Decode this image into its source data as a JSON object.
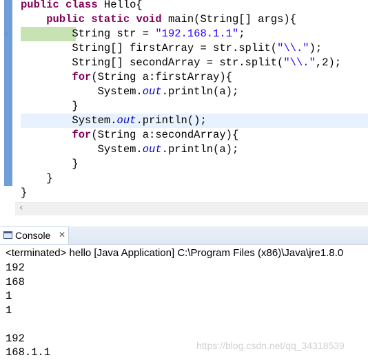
{
  "editor": {
    "lines": [
      [
        [
          "kw",
          "public class "
        ],
        [
          "t",
          "Hello{"
        ]
      ],
      [
        [
          "t",
          "    "
        ],
        [
          "kw",
          "public static void "
        ],
        [
          "t",
          "main(String[] args){"
        ]
      ],
      [
        [
          "t",
          "        String str = "
        ],
        [
          "str",
          "\"192.168.1.1\""
        ],
        [
          "t",
          ";"
        ]
      ],
      [
        [
          "t",
          "        String[] firstArray = str.split("
        ],
        [
          "str",
          "\"\\\\.\""
        ],
        [
          "t",
          ");"
        ]
      ],
      [
        [
          "t",
          "        String[] secondArray = str.split("
        ],
        [
          "str",
          "\"\\\\.\""
        ],
        [
          "t",
          ",2);"
        ]
      ],
      [
        [
          "t",
          "        "
        ],
        [
          "kw",
          "for"
        ],
        [
          "t",
          "(String a:firstArray){"
        ]
      ],
      [
        [
          "t",
          "            System."
        ],
        [
          "fld",
          "out"
        ],
        [
          "t",
          ".println(a);"
        ]
      ],
      [
        [
          "t",
          "        }"
        ]
      ],
      [
        [
          "t",
          "        System."
        ],
        [
          "fld",
          "out"
        ],
        [
          "t",
          ".println();"
        ]
      ],
      [
        [
          "t",
          "        "
        ],
        [
          "kw",
          "for"
        ],
        [
          "t",
          "(String a:secondArray){"
        ]
      ],
      [
        [
          "t",
          "            System."
        ],
        [
          "fld",
          "out"
        ],
        [
          "t",
          ".println(a);"
        ]
      ],
      [
        [
          "t",
          "        }"
        ]
      ],
      [
        [
          "t",
          "    }"
        ]
      ],
      [
        [
          "t",
          "}"
        ]
      ]
    ],
    "current_line_index": 8,
    "hscroll_left_arrow": "‹"
  },
  "console": {
    "tab_label": "Console",
    "tab_icon": "console-icon",
    "close_glyph": "✕",
    "header": "<terminated> hello [Java Application] C:\\Program Files (x86)\\Java\\jre1.8.0",
    "output": [
      "192",
      "168",
      "1",
      "1",
      "",
      "192",
      "168.1.1"
    ]
  },
  "watermark": "https://blog.csdn.net/qq_34318539",
  "colors": {
    "keyword": "#7f0055",
    "string": "#2a00ff",
    "field": "#0000c0",
    "current_line": "#e8f2fe",
    "selection": "#c7e3b4",
    "ruler": "#6f9ed8"
  }
}
